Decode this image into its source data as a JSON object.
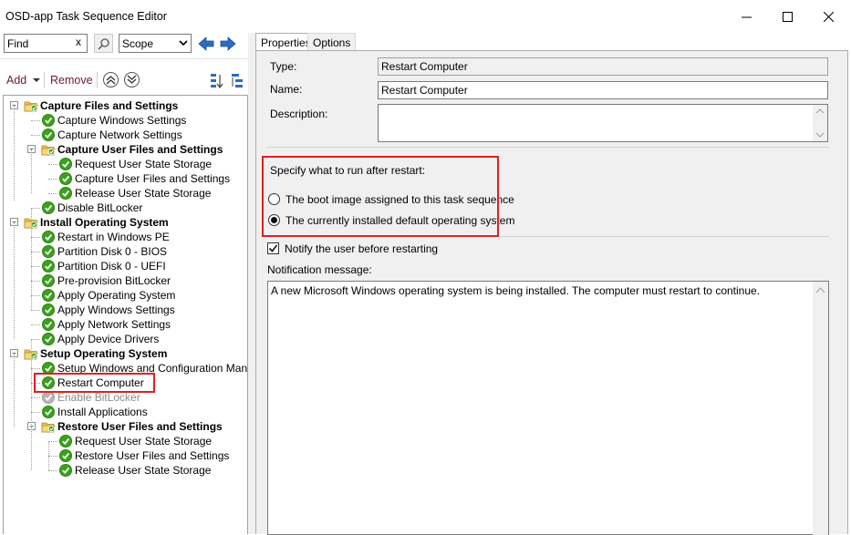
{
  "window": {
    "title": "OSD-app Task Sequence Editor"
  },
  "toolbar": {
    "find_value": "Find",
    "find_clear": "x",
    "scope_value": "Scope",
    "add_label": "Add",
    "remove_label": "Remove"
  },
  "tree": {
    "items": [
      {
        "label": "Capture Files and Settings",
        "group": true
      },
      {
        "label": "Capture Windows Settings"
      },
      {
        "label": "Capture Network Settings"
      },
      {
        "label": "Capture User Files and Settings",
        "group": true
      },
      {
        "label": "Request User State Storage"
      },
      {
        "label": "Capture User Files and Settings"
      },
      {
        "label": "Release User State Storage"
      },
      {
        "label": "Disable BitLocker"
      },
      {
        "label": "Install Operating System",
        "group": true
      },
      {
        "label": "Restart in Windows PE"
      },
      {
        "label": "Partition Disk 0 - BIOS"
      },
      {
        "label": "Partition Disk 0 - UEFI"
      },
      {
        "label": "Pre-provision BitLocker"
      },
      {
        "label": "Apply Operating System"
      },
      {
        "label": "Apply Windows Settings"
      },
      {
        "label": "Apply Network Settings"
      },
      {
        "label": "Apply Device Drivers"
      },
      {
        "label": "Setup Operating System",
        "group": true
      },
      {
        "label": "Setup Windows and Configuration Manager"
      },
      {
        "label": "Restart Computer",
        "selected": true
      },
      {
        "label": "Enable BitLocker",
        "disabled": true
      },
      {
        "label": "Install Applications"
      },
      {
        "label": "Restore User Files and Settings",
        "group": true
      },
      {
        "label": "Request User State Storage"
      },
      {
        "label": "Restore User Files and Settings"
      },
      {
        "label": "Release User State Storage"
      }
    ]
  },
  "tabs": {
    "properties": "Properties",
    "options": "Options"
  },
  "properties": {
    "type_label": "Type:",
    "type_value": "Restart Computer",
    "name_label": "Name:",
    "name_value": "Restart Computer",
    "description_label": "Description:",
    "description_value": "",
    "restart_group_label": "Specify what to run after restart:",
    "radio_boot_image": "The boot image assigned to this task sequence",
    "radio_installed_os": "The currently installed default operating system",
    "selected_radio": "installed_os",
    "notify_label": "Notify the user before restarting",
    "notify_checked": true,
    "notification_label": "Notification message:",
    "notification_value": "A new Microsoft Windows operating system is being installed. The computer must restart to continue."
  },
  "colors": {
    "highlight": "#e0201e",
    "action_text": "#6b1a36",
    "check_green": "#3aa11b",
    "arrow_blue": "#2b6cc4"
  }
}
